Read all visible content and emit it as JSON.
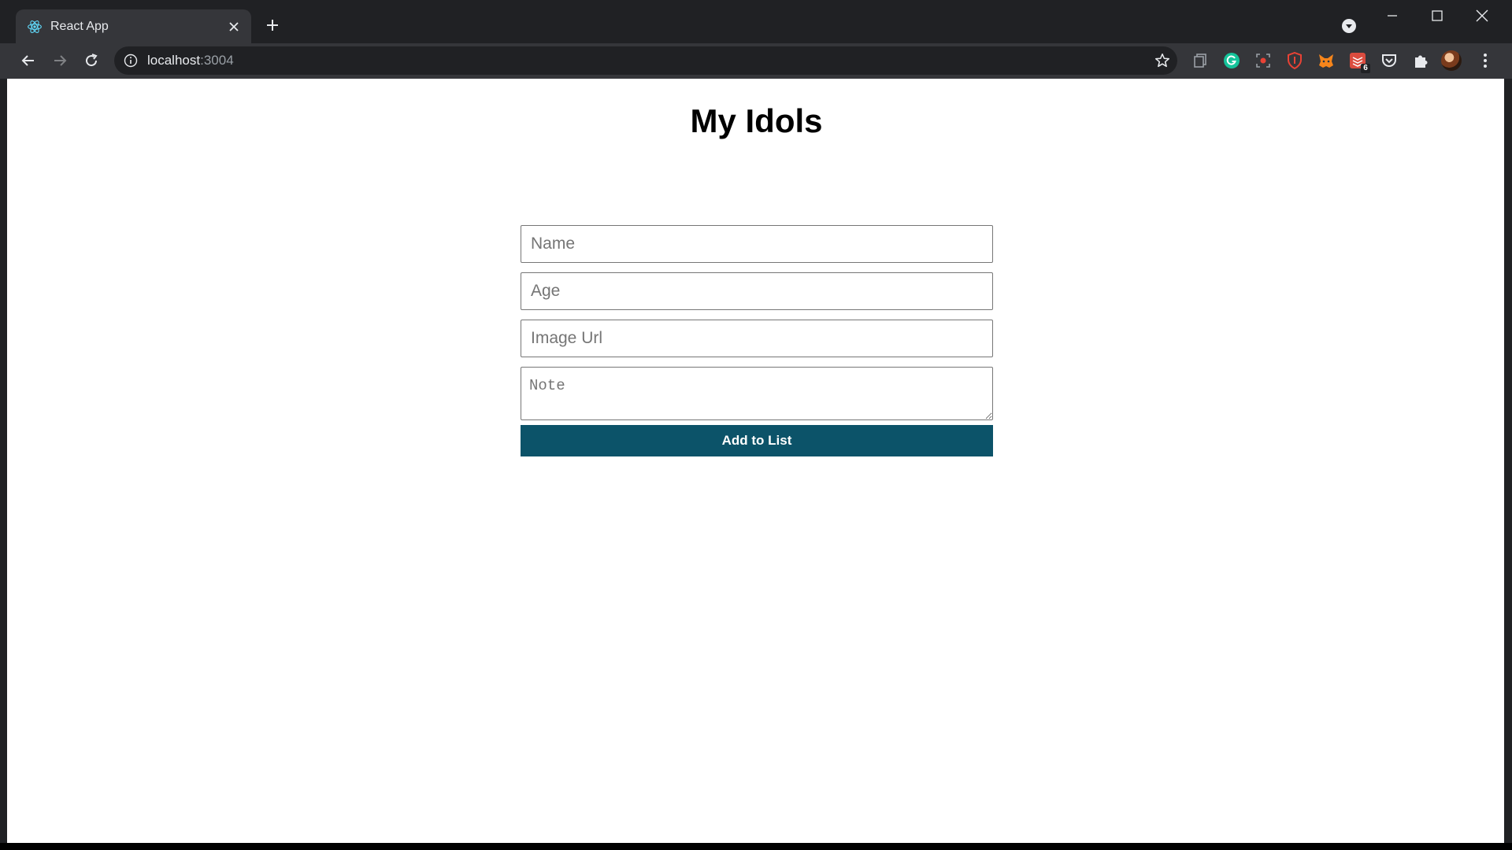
{
  "browser": {
    "tab": {
      "title": "React App"
    },
    "address": {
      "host": "localhost",
      "port": ":3004"
    },
    "extensions": [
      {
        "name": "files-icon"
      },
      {
        "name": "grammarly-icon",
        "color": "#15c39a"
      },
      {
        "name": "screen-capture-icon",
        "color": "#e94235"
      },
      {
        "name": "shield-icon",
        "color": "#e94235"
      },
      {
        "name": "metamask-icon",
        "color": "#f6851b"
      },
      {
        "name": "todoist-icon",
        "color": "#db4c3f",
        "badge": "6"
      },
      {
        "name": "pocket-icon"
      },
      {
        "name": "puzzle-icon"
      }
    ]
  },
  "page": {
    "title": "My Idols",
    "form": {
      "name_placeholder": "Name",
      "age_placeholder": "Age",
      "image_placeholder": "Image Url",
      "note_placeholder": "Note",
      "submit_label": "Add to List"
    },
    "colors": {
      "button": "#0c5369"
    }
  }
}
